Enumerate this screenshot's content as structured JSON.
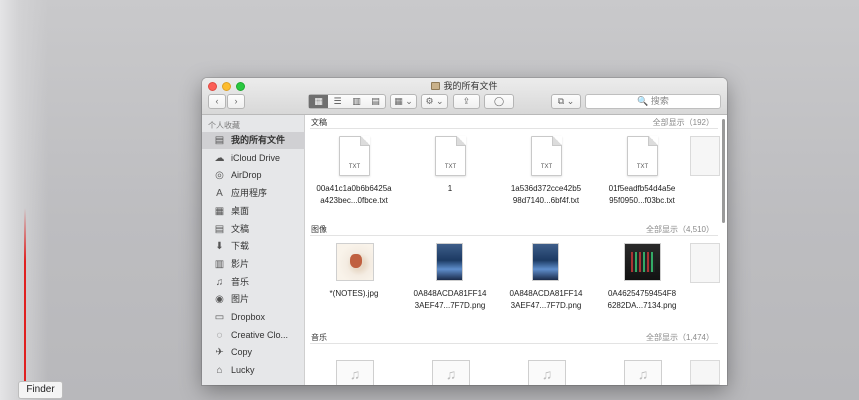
{
  "window": {
    "title": "我的所有文件"
  },
  "toolbar": {
    "view_icons": "▦",
    "view_list": "☰",
    "view_columns": "▥",
    "view_coverflow": "▤",
    "arrange": "▦ ⌄",
    "action": "⚙ ⌄",
    "share": "⇪",
    "tags": "◯",
    "dropbox": "⧉ ⌄",
    "search_placeholder": "🔍 搜索"
  },
  "sidebar": {
    "header": "个人收藏",
    "items": [
      {
        "label": "我的所有文件",
        "icon": "all-files-icon",
        "glyph": "▤",
        "selected": true
      },
      {
        "label": "iCloud Drive",
        "icon": "cloud-icon",
        "glyph": "☁"
      },
      {
        "label": "AirDrop",
        "icon": "airdrop-icon",
        "glyph": "◎"
      },
      {
        "label": "应用程序",
        "icon": "applications-icon",
        "glyph": "A"
      },
      {
        "label": "桌面",
        "icon": "desktop-icon",
        "glyph": "▦"
      },
      {
        "label": "文稿",
        "icon": "documents-icon",
        "glyph": "▤"
      },
      {
        "label": "下载",
        "icon": "downloads-icon",
        "glyph": "⬇"
      },
      {
        "label": "影片",
        "icon": "movies-icon",
        "glyph": "▥"
      },
      {
        "label": "音乐",
        "icon": "music-icon",
        "glyph": "♫"
      },
      {
        "label": "图片",
        "icon": "pictures-icon",
        "glyph": "◉"
      },
      {
        "label": "Dropbox",
        "icon": "folder-icon",
        "glyph": "▭"
      },
      {
        "label": "Creative Clo...",
        "icon": "creative-cloud-icon",
        "glyph": "◌"
      },
      {
        "label": "Copy",
        "icon": "copy-icon",
        "glyph": "✈"
      },
      {
        "label": "Lucky",
        "icon": "home-icon",
        "glyph": "⌂"
      }
    ]
  },
  "sections": {
    "documents": {
      "title": "文稿",
      "show_all": "全部显示（192）",
      "files": [
        {
          "ext": "TXT",
          "name_line1": "00a41c1a0b6b6425a",
          "name_line2": "a423bec...0fbce.txt"
        },
        {
          "ext": "TXT",
          "name_line1": "1",
          "name_line2": ""
        },
        {
          "ext": "TXT",
          "name_line1": "1a536d372cce42b5",
          "name_line2": "98d7140...6bf4f.txt"
        },
        {
          "ext": "TXT",
          "name_line1": "01f5eadfb54d4a5e",
          "name_line2": "95f0950...f03bc.txt"
        }
      ]
    },
    "images": {
      "title": "图像",
      "show_all": "全部显示（4,510）",
      "files": [
        {
          "name_line1": "*(NOTES).jpg",
          "name_line2": ""
        },
        {
          "name_line1": "0A848ACDA81FF14",
          "name_line2": "3AEF47...7F7D.png"
        },
        {
          "name_line1": "0A848ACDA81FF14",
          "name_line2": "3AEF47...7F7D.png"
        },
        {
          "name_line1": "0A46254759454F8",
          "name_line2": "6282DA...7134.png"
        }
      ]
    },
    "music": {
      "title": "音乐",
      "show_all": "全部显示（1,474）",
      "note": "♫"
    }
  },
  "dock_tooltip": "Finder"
}
